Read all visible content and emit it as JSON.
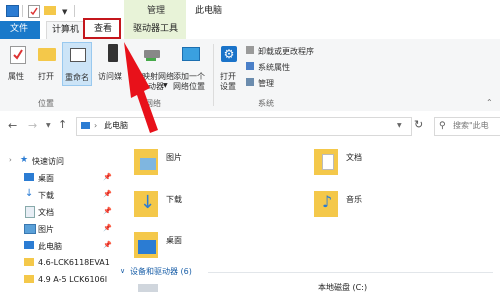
{
  "contextual_tab": "管理",
  "window_title": "此电脑",
  "tabs": {
    "file": "文件",
    "computer": "计算机",
    "view": "查看",
    "drive_tools": "驱动器工具"
  },
  "ribbon": {
    "properties": "属性",
    "open": "打开",
    "rename": "重命名",
    "access_media_part1": "访问媒",
    "map_network_part1": "映射网络",
    "map_network_part2": "动器",
    "add_network_location_line1": "添加一个",
    "add_network_location_line2": "网络位置",
    "open_settings_line1": "打开",
    "open_settings_line2": "设置",
    "uninstall": "卸载或更改程序",
    "system_properties": "系统属性",
    "manage": "管理",
    "group_location": "位置",
    "group_network": "网络",
    "group_system": "系统"
  },
  "address": {
    "path": "此电脑",
    "search_placeholder": "搜索\"此电"
  },
  "sidebar": {
    "quick_access": "快速访问",
    "items": [
      {
        "label": "桌面",
        "pinned": true
      },
      {
        "label": "下载",
        "pinned": true
      },
      {
        "label": "文档",
        "pinned": true
      },
      {
        "label": "图片",
        "pinned": true
      },
      {
        "label": "此电脑",
        "pinned": true
      },
      {
        "label": "4.6-LCK6118EVA1",
        "pinned": false
      },
      {
        "label": "4.9  A-5 LCK6106I",
        "pinned": false
      }
    ]
  },
  "folders": [
    {
      "label": "图片"
    },
    {
      "label": "文档"
    },
    {
      "label": "下载"
    },
    {
      "label": "音乐"
    },
    {
      "label": "桌面"
    }
  ],
  "devices_header": "设备和驱动器 (6)",
  "local_disk_partial": "本地磁盘 (C:)",
  "colors": {
    "file_tab": "#1979ca",
    "contextual": "#e8f3d8",
    "highlight_box": "#c4161c",
    "arrow": "#e8111a",
    "folder_yellow": "#f4c84a"
  }
}
